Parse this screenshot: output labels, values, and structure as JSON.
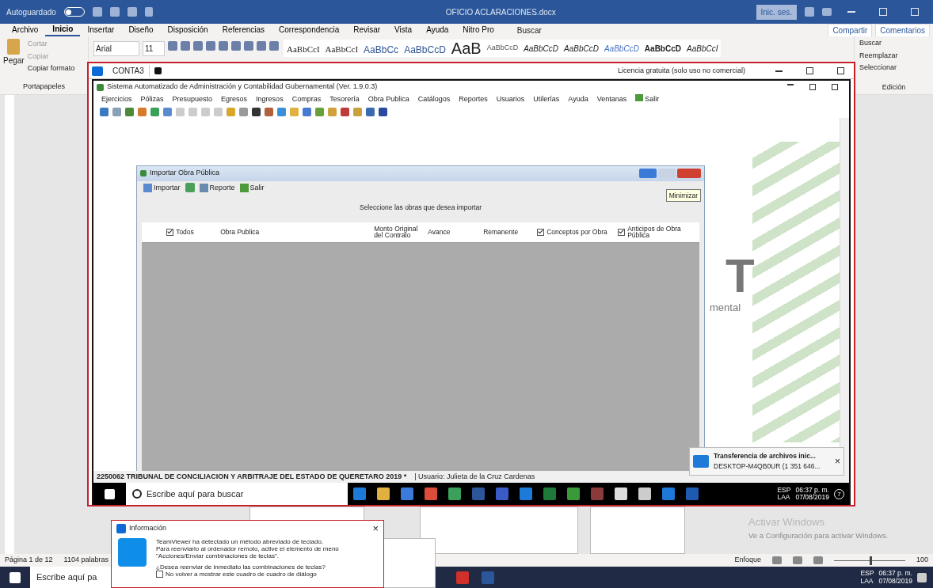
{
  "word": {
    "autosave": {
      "label": "Autoguardado",
      "on": false
    },
    "title": "OFICIO ACLARACIONES.docx",
    "sign_in": "Inic. ses.",
    "tabs": [
      {
        "label": "Archivo",
        "selected": false
      },
      {
        "label": "Inicio",
        "selected": true
      },
      {
        "label": "Insertar",
        "selected": false
      },
      {
        "label": "Diseño",
        "selected": false
      },
      {
        "label": "Disposición",
        "selected": false
      },
      {
        "label": "Referencias",
        "selected": false
      },
      {
        "label": "Correspondencia",
        "selected": false
      },
      {
        "label": "Revisar",
        "selected": false
      },
      {
        "label": "Vista",
        "selected": false
      },
      {
        "label": "Ayuda",
        "selected": false
      },
      {
        "label": "Nitro Pro",
        "selected": false
      }
    ],
    "search": "Buscar",
    "share": "Compartir",
    "comments": "Comentarios",
    "clipboard": {
      "paste": "Pegar",
      "items": [
        "Cortar",
        "Copiar",
        "Copiar formato"
      ],
      "group": "Portapapeles"
    },
    "font": "Arial",
    "size": "11",
    "styles": [
      {
        "sample": "AaBbCcI",
        "kind": "serif"
      },
      {
        "sample": "AaBbCcI",
        "kind": "serif"
      },
      {
        "sample": "AaBbCc",
        "kind": "heading"
      },
      {
        "sample": "AaBbCcD",
        "kind": "heading"
      },
      {
        "sample": "AaB",
        "kind": "title"
      },
      {
        "sample": "AaBbCcD",
        "kind": "plain"
      },
      {
        "sample": "AaBbCcD",
        "kind": "italic"
      },
      {
        "sample": "AaBbCcD",
        "kind": "italic"
      },
      {
        "sample": "AaBbCcD",
        "kind": "accent"
      },
      {
        "sample": "AaBbCcD",
        "kind": "bold"
      },
      {
        "sample": "AaBbCcI",
        "kind": "italic"
      }
    ],
    "editing": {
      "items": [
        "Buscar",
        "Reemplazar",
        "Seleccionar"
      ],
      "group": "Edición"
    },
    "status": {
      "page": "Página 1 de 12",
      "words": "1104 palabras",
      "focus": "Enfoque",
      "zoom_slider": {
        "level": 0.5
      },
      "zoom": "100"
    }
  },
  "teamviewer": {
    "tab": "CONTA3",
    "license": "Licencia gratuita (solo uso no comercial)"
  },
  "app": {
    "title": "Sistema Automatizado de Administración y Contabilidad Gubernamental  (Ver. 1.9.0.3)",
    "menu": [
      "Ejercicios",
      "Pólizas",
      "Presupuesto",
      "Egresos",
      "Ingresos",
      "Compras",
      "Tesorería",
      "Obra Publica",
      "Catálogos",
      "Reportes",
      "Usuarios",
      "Utilerías",
      "Ayuda",
      "Ventanas",
      "Salir"
    ],
    "background_texts": [
      "T",
      "mental"
    ],
    "status_entity": "2250062 TRIBUNAL DE CONCILIACION Y ARBITRAJE DEL ESTADO DE QUERETARO  2019   *",
    "status_user": "| Usuario: Julieta de la Cruz Cardenas"
  },
  "dialog": {
    "title": "Importar Obra Pública",
    "toolbar": [
      "Importar",
      "Reporte",
      "Salir"
    ],
    "tooltip": "Minimizar",
    "prompt": "Seleccione las obras que desea importar",
    "columns": [
      {
        "label": "Todos",
        "kind": "checkbox",
        "checked": true
      },
      {
        "label": "Obra Publica",
        "kind": "text"
      },
      {
        "label": "Monto Original del Contrato",
        "kind": "text"
      },
      {
        "label": "Avance",
        "kind": "text"
      },
      {
        "label": "Remanente",
        "kind": "text"
      },
      {
        "label": "Conceptos por Obra",
        "kind": "checkbox",
        "checked": true
      },
      {
        "label": "Anticipos de Obra Pública",
        "kind": "checkbox",
        "checked": true
      }
    ]
  },
  "remote_taskbar": {
    "search": "Escribe aquí para buscar",
    "lang": "ESP",
    "layout": "LAA",
    "time": "06:37 p. m.",
    "date": "07/08/2019",
    "notifications": "7"
  },
  "notification": {
    "title": "Transferencia de archivos inic...",
    "subtitle": "DESKTOP-M4QB0UR (1 351 646...",
    "close": "×"
  },
  "info_dialog": {
    "title": "Información",
    "close": "×",
    "message": [
      "TeamViewer ha detectado un método abreviado de teclado.",
      "Para reenviarlo al ordenador remoto, active el elemento de menú",
      "\"Acciones/Enviar combinaciones de teclas\"."
    ],
    "question": "¿Desea reenviar de inmediato las combinaciones de teclas?",
    "checkbox": {
      "label": "No volver a mostrar este cuadro de cuadro de diálogo",
      "checked": false
    }
  },
  "activation": {
    "title": "Activar Windows",
    "subtitle": "Ve a Configuración para activar Windows."
  },
  "local_taskbar": {
    "search": "Escribe aquí pa",
    "lang": "ESP",
    "layout": "LAA",
    "time": "06:37 p. m.",
    "date": "07/08/2019"
  }
}
